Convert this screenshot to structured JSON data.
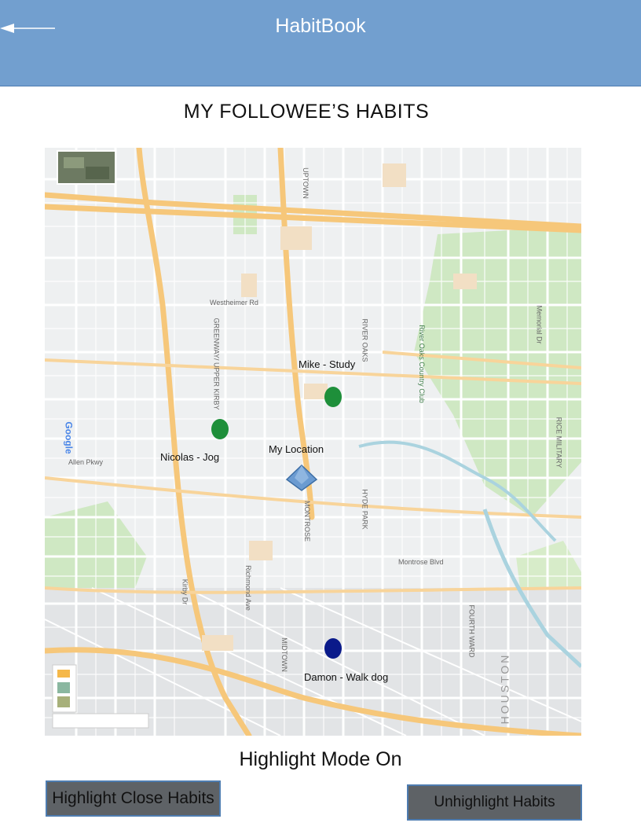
{
  "header": {
    "title": "HabitBook",
    "back_icon": "back-arrow-icon",
    "color": "#729fcf"
  },
  "page": {
    "title": "MY FOLLOWEE’S HABITS"
  },
  "map": {
    "markers": [
      {
        "label": "Mike - Study",
        "color": "#1e8f3a",
        "icon": "map-pin-icon"
      },
      {
        "label": "Nicolas - Jog",
        "color": "#1e8f3a",
        "icon": "map-pin-icon"
      },
      {
        "label": "My Location",
        "color": "#6b9bd1",
        "icon": "location-diamond-icon"
      },
      {
        "label": "Damon - Walk dog",
        "color": "#0a1a8a",
        "icon": "map-pin-icon"
      }
    ],
    "street_labels": [
      "UPTOWN",
      "GREENWAY/ UPPER KIRBY",
      "RIVER OAKS",
      "HYDE PARK",
      "MONTROSE",
      "MIDTOWN",
      "FOURTH WARD",
      "RICE MILITARY",
      "HOUSTON",
      "River Oaks Country Club",
      "Memorial Dr",
      "Westheimer Rd",
      "Richmond Ave",
      "Kirby Dr",
      "Montrose Blvd",
      "Allen Pkwy",
      "Google"
    ]
  },
  "status": {
    "text": "Highlight Mode On"
  },
  "buttons": {
    "highlight_close": "Highlight Close Habits",
    "unhighlight": "Unhighlight Habits"
  }
}
